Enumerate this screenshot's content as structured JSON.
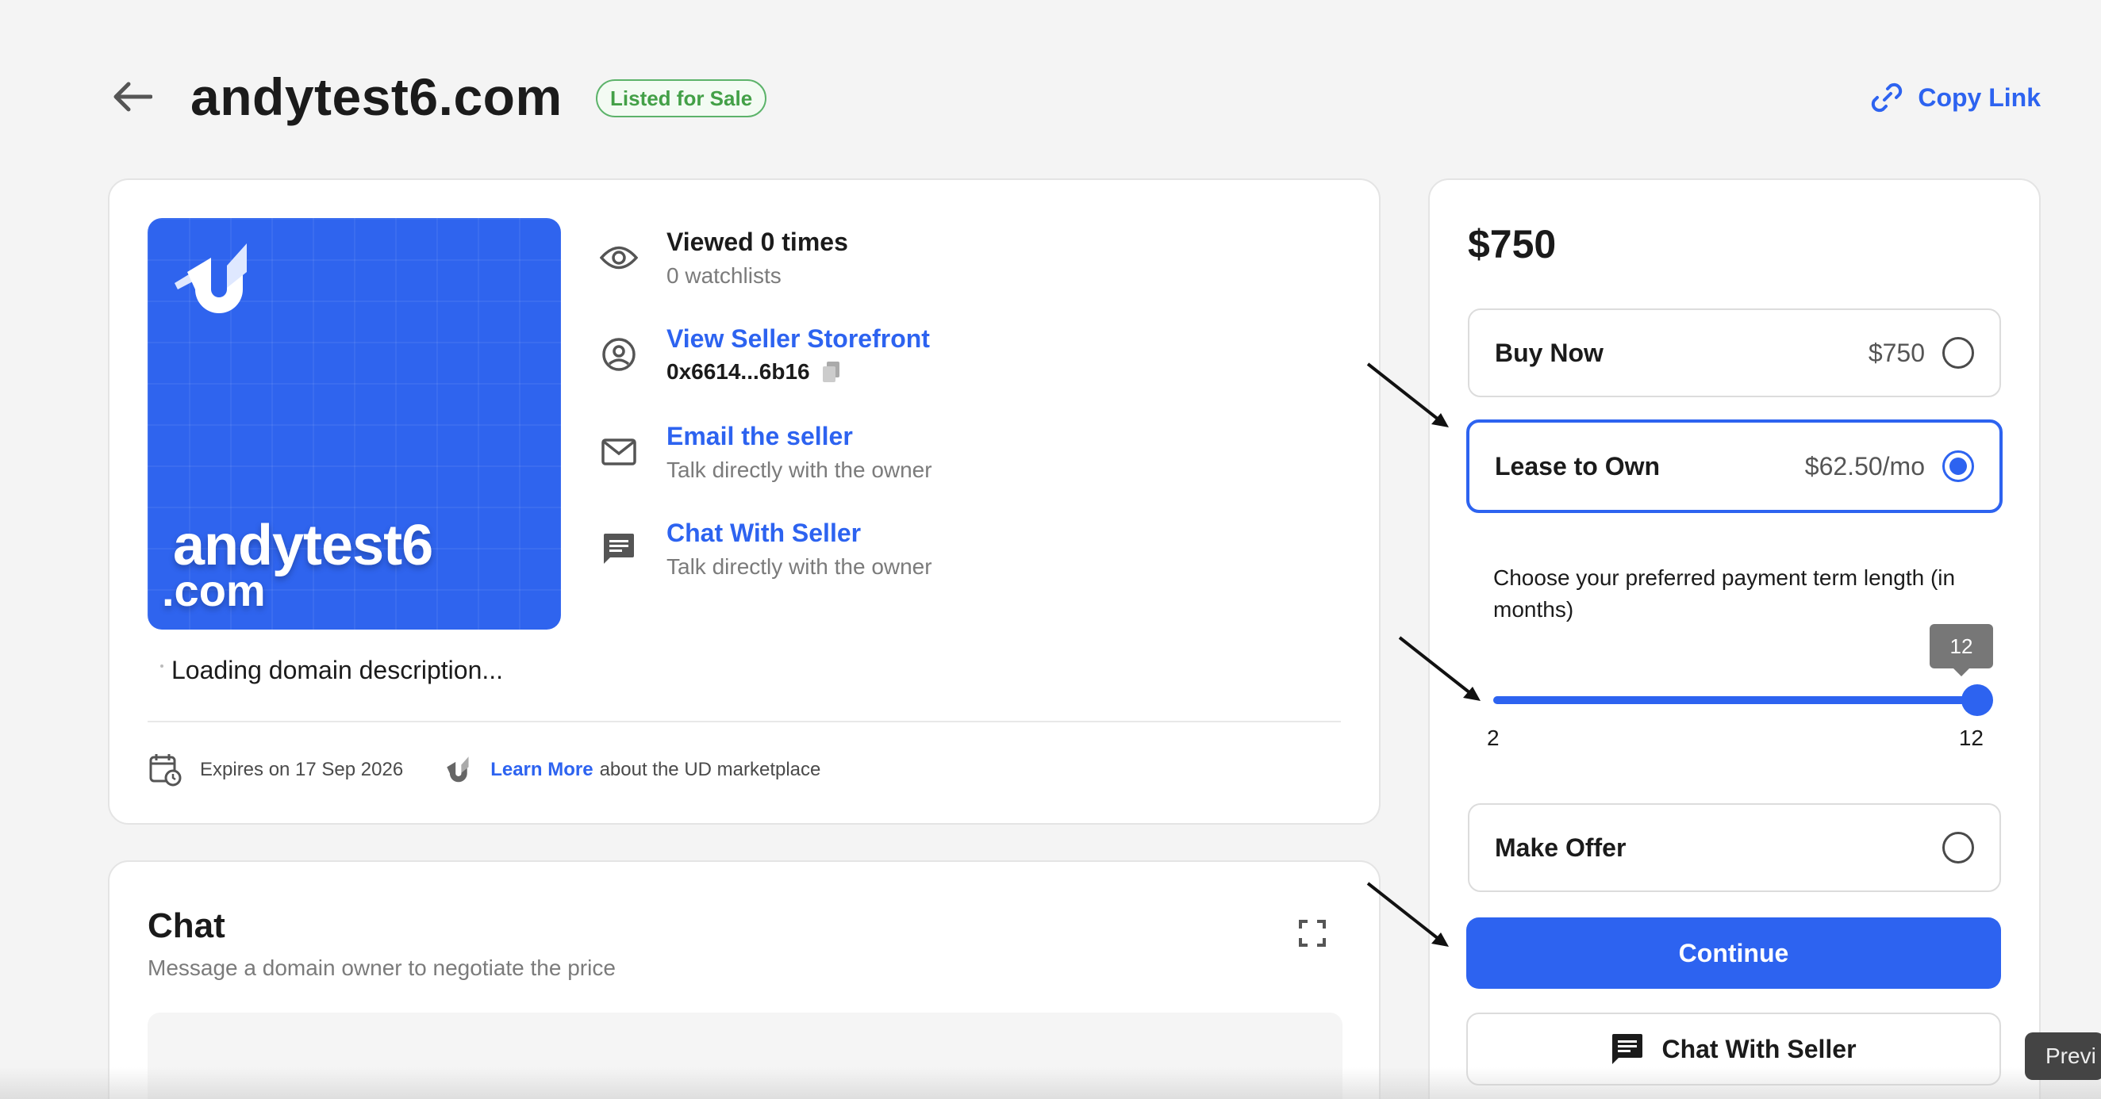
{
  "header": {
    "domain": "andytest6.com",
    "status": "Listed for Sale",
    "copy_link": "Copy Link"
  },
  "art": {
    "name": "andytest6",
    "tld": ".com"
  },
  "info": {
    "viewed": "Viewed 0 times",
    "watchlists": "0 watchlists",
    "storefront": "View Seller Storefront",
    "address": "0x6614...6b16",
    "email": "Email the seller",
    "email_sub": "Talk directly with the owner",
    "chat": "Chat With Seller",
    "chat_sub": "Talk directly with the owner"
  },
  "description": "Loading domain description...",
  "footer": {
    "expires": "Expires on 17 Sep 2026",
    "learn_more": "Learn More",
    "about": "about the UD marketplace"
  },
  "chat_card": {
    "title": "Chat",
    "subtitle": "Message a domain owner to negotiate the price"
  },
  "purchase": {
    "price": "$750",
    "options": [
      {
        "label": "Buy Now",
        "price": "$750",
        "selected": false
      },
      {
        "label": "Lease to Own",
        "price": "$62.50/mo",
        "selected": true
      },
      {
        "label": "Make Offer",
        "price": "",
        "selected": false
      }
    ],
    "term_label": "Choose your preferred payment term length (in months)",
    "slider": {
      "min": "2",
      "max": "12",
      "value": "12",
      "fraction": 1.0
    },
    "continue": "Continue",
    "chat_button": "Chat With Seller"
  },
  "tooltip": "Previ",
  "colors": {
    "accent": "#2d63f0",
    "status_green": "#43a047",
    "background": "#f4f4f4"
  }
}
